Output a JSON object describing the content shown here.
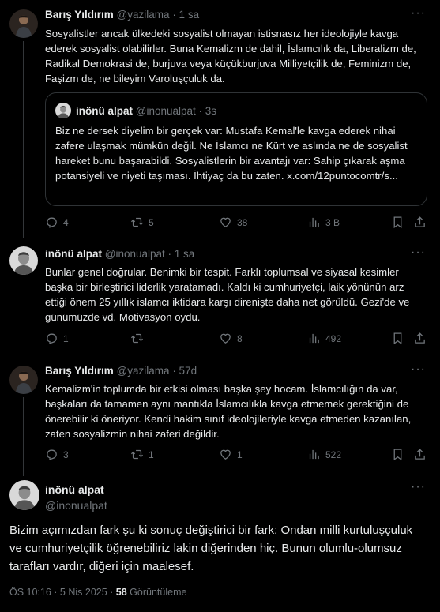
{
  "tweets": [
    {
      "name": "Barış Yıldırım",
      "handle": "@yazilama",
      "time": "· 1 sa",
      "more": "···",
      "text": "Sosyalistler ancak ülkedeki sosyalist olmayan istisnasız her ideolojiyle kavga ederek sosyalist olabilirler. Buna Kemalizm de dahil, İslamcılık da, Liberalizm de, Radikal Demokrasi de, burjuva veya küçükburjuva Milliyetçilik de, Feminizm de, Faşizm de, ne bileyim Varoluşçuluk da.",
      "quote": {
        "name": "inönü alpat",
        "handle": "@inonualpat",
        "time": "· 3s",
        "text": "Biz ne dersek diyelim bir gerçek var: Mustafa Kemal'le kavga ederek nihai zafere ulaşmak mümkün değil. Ne İslamcı ne Kürt ve aslında ne de sosyalist hareket bunu başarabildi. Sosyalistlerin bir avantajı var: Sahip çıkarak aşma potansiyeli ve niyeti taşıması. İhtiyaç da bu zaten. x.com/12puntocomtr/s..."
      },
      "replies": "4",
      "reposts": "5",
      "likes": "38",
      "views": "3 B"
    },
    {
      "name": "inönü alpat",
      "handle": "@inonualpat",
      "time": "· 1 sa",
      "more": "···",
      "text": "Bunlar genel doğrular. Benimki bir tespit. Farklı toplumsal ve siyasal kesimler başka bir birleştirici liderlik yaratamadı. Kaldı ki cumhuriyetçi, laik yönünün arz ettiği önem 25 yıllık islamcı iktidara karşı direnişte daha net görüldü. Gezi'de ve günümüzde vd. Motivasyon oydu.",
      "replies": "1",
      "reposts": "",
      "likes": "8",
      "views": "492"
    },
    {
      "name": "Barış Yıldırım",
      "handle": "@yazilama",
      "time": "· 57d",
      "more": "···",
      "text": "Kemalizm'in toplumda bir etkisi olması başka şey hocam. İslamcılığın da var, başkaları da tamamen aynı mantıkla İslamcılıkla kavga etmemek gerektiğini de önerebilir ki öneriyor. Kendi hakim sınıf ideolojileriyle kavga etmeden kazanılan, zaten sosyalizmin nihai zaferi değildir.",
      "replies": "3",
      "reposts": "1",
      "likes": "1",
      "views": "522"
    }
  ],
  "main": {
    "name": "inönü alpat",
    "handle": "@inonualpat",
    "more": "···",
    "text": "Bizim açımızdan fark şu ki sonuç değiştirici bir fark: Ondan milli kurtuluşçuluk ve cumhuriyetçilik öğrenebiliriz lakin diğerinden hiç. Bunun olumlu-olumsuz tarafları vardır, diğeri için maalesef.",
    "timestamp": "ÖS 10:16 · 5 Nis 2025 · ",
    "views_count": "58",
    "views_label": " Görüntüleme"
  },
  "colors": {
    "background": "#000000",
    "text": "#e7e9ea",
    "muted": "#71767b",
    "border": "#2f3336"
  }
}
